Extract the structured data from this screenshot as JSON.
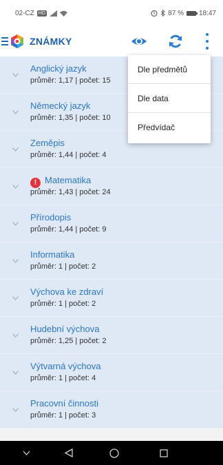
{
  "status_bar": {
    "left_text": "02-CZ",
    "chip": "HD",
    "right_text": "87 %",
    "time": "18:47"
  },
  "app": {
    "title": "ZNÁMKY",
    "accent_color": "#1e5fb0",
    "icons": [
      "menu-icon",
      "app-logo",
      "eye-icon",
      "refresh-icon",
      "more-icon"
    ]
  },
  "menu": {
    "items": [
      {
        "label": "Dle předmětů"
      },
      {
        "label": "Dle data"
      },
      {
        "label": "Předvídač"
      }
    ]
  },
  "subjects": [
    {
      "name": "Anglický jazyk",
      "stats": "průměr: 1,17 | počet: 15",
      "alert": false
    },
    {
      "name": "Německý jazyk",
      "stats": "průměr: 1,35 | počet: 10",
      "alert": false
    },
    {
      "name": "Zeměpis",
      "stats": "průměr: 1,44 | počet: 4",
      "alert": false
    },
    {
      "name": "Matematika",
      "stats": "průměr: 1,43 | počet: 24",
      "alert": true,
      "alert_glyph": "!"
    },
    {
      "name": "Přírodopis",
      "stats": "průměr: 1,44 | počet: 9",
      "alert": false
    },
    {
      "name": "Informatika",
      "stats": "průměr: 1 | počet: 2",
      "alert": false
    },
    {
      "name": "Výchova ke zdraví",
      "stats": "průměr: 1 | počet: 2",
      "alert": false
    },
    {
      "name": "Hudební výchova",
      "stats": "průměr: 1,25 | počet: 2",
      "alert": false
    },
    {
      "name": "Výtvarná výchova",
      "stats": "průměr: 1 | počet: 4",
      "alert": false
    },
    {
      "name": "Pracovní činnosti",
      "stats": "průměr: 1 | počet: 3",
      "alert": false
    }
  ],
  "nav_bar": {
    "buttons": [
      "chevron-down-icon",
      "back-icon",
      "home-icon",
      "recents-icon"
    ]
  }
}
